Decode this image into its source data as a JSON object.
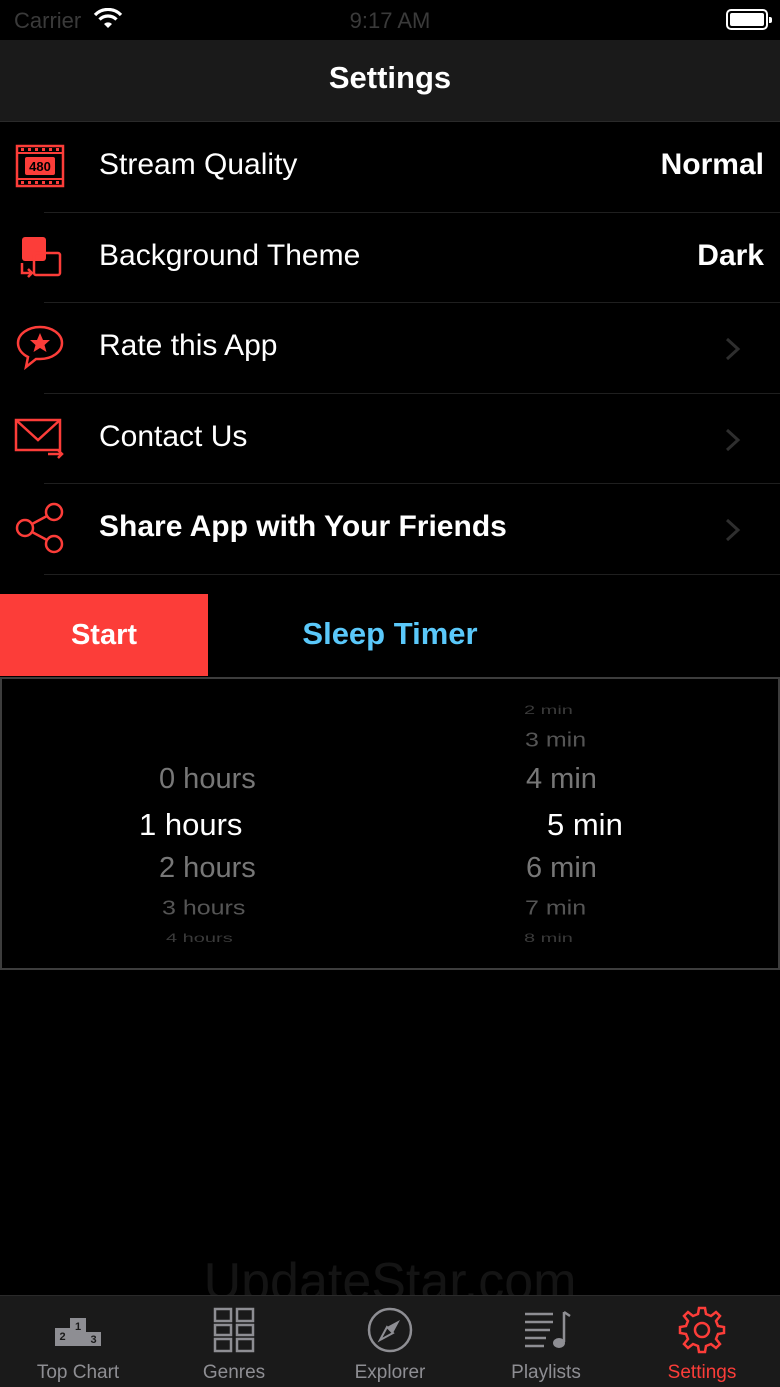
{
  "status_bar": {
    "carrier": "Carrier",
    "time": "9:17 AM"
  },
  "nav": {
    "title": "Settings"
  },
  "settings": [
    {
      "label": "Stream Quality",
      "value": "Normal",
      "icon": "video-quality-icon",
      "icon_text": "480"
    },
    {
      "label": "Background Theme",
      "value": "Dark",
      "icon": "theme-switch-icon"
    },
    {
      "label": "Rate this App",
      "icon": "star-bubble-icon",
      "chevron": true
    },
    {
      "label": "Contact Us",
      "icon": "envelope-icon",
      "chevron": true
    },
    {
      "label": "Share App with Your Friends",
      "icon": "share-icon",
      "chevron": true
    }
  ],
  "sleep_timer": {
    "start_label": "Start",
    "title": "Sleep Timer",
    "hours": [
      "0 hours",
      "1 hours",
      "2 hours",
      "3 hours",
      "4 hours"
    ],
    "selected_hours": "1 hours",
    "minutes": [
      "2 min",
      "3 min",
      "4 min",
      "5 min",
      "6 min",
      "7 min",
      "8 min"
    ],
    "selected_minutes": "5 min"
  },
  "watermark": "UpdateStar.com",
  "tabs": [
    {
      "label": "Top Chart",
      "icon": "podium-icon"
    },
    {
      "label": "Genres",
      "icon": "grid-icon"
    },
    {
      "label": "Explorer",
      "icon": "compass-icon"
    },
    {
      "label": "Playlists",
      "icon": "playlist-icon"
    },
    {
      "label": "Settings",
      "icon": "gear-icon",
      "active": true
    }
  ],
  "colors": {
    "accent": "#fc3d39",
    "link": "#5ac8fa",
    "background": "#000000",
    "bar": "#1a1a1a"
  }
}
